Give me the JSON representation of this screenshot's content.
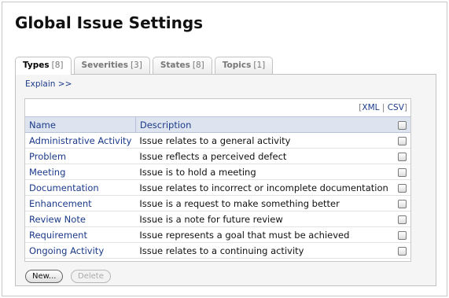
{
  "page": {
    "title": "Global Issue Settings"
  },
  "tabs": [
    {
      "label": "Types",
      "count": "[8]"
    },
    {
      "label": "Severities",
      "count": "[3]"
    },
    {
      "label": "States",
      "count": "[8]"
    },
    {
      "label": "Topics",
      "count": "[1]"
    }
  ],
  "panel": {
    "explain_link": "Explain >>"
  },
  "export": {
    "open": "[",
    "xml": "XML",
    "sep": " | ",
    "csv": "CSV",
    "close": "]"
  },
  "table": {
    "columns": {
      "name": "Name",
      "description": "Description"
    },
    "rows": [
      {
        "name": "Administrative Activity",
        "description": "Issue relates to a general activity"
      },
      {
        "name": "Problem",
        "description": "Issue reflects a perceived defect"
      },
      {
        "name": "Meeting",
        "description": "Issue is to hold a meeting"
      },
      {
        "name": "Documentation",
        "description": "Issue relates to incorrect or incomplete documentation"
      },
      {
        "name": "Enhancement",
        "description": "Issue is a request to make something better"
      },
      {
        "name": "Review Note",
        "description": "Issue is a note for future review"
      },
      {
        "name": "Requirement",
        "description": "Issue represents a goal that must be achieved"
      },
      {
        "name": "Ongoing Activity",
        "description": "Issue relates to a continuing activity"
      }
    ]
  },
  "buttons": {
    "new": "New...",
    "delete": "Delete"
  },
  "colors": {
    "link": "#1b3a8a",
    "header_bg": "#dde4f0",
    "panel_bg": "#f5f5f5"
  }
}
